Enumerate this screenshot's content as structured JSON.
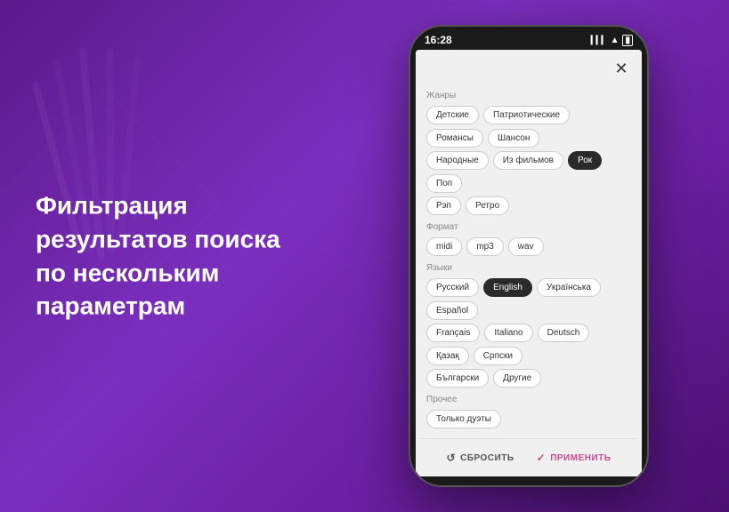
{
  "background": {
    "gradient_start": "#5a1a8a",
    "gradient_end": "#4a1070"
  },
  "hero_text": {
    "line1": "Фильтрация",
    "line2": "результатов поиска",
    "line3": "по нескольким",
    "line4": "параметрам"
  },
  "phone": {
    "status_bar": {
      "time": "16:28",
      "signal": "▲▲▲",
      "wifi": "WiFi",
      "battery": "🔋"
    },
    "close_button_label": "✕",
    "sections": [
      {
        "id": "genres",
        "label": "Жанры",
        "tags": [
          {
            "label": "Детские",
            "active": false
          },
          {
            "label": "Патриотические",
            "active": false
          },
          {
            "label": "Романсы",
            "active": false
          },
          {
            "label": "Шансон",
            "active": false
          },
          {
            "label": "Народные",
            "active": false
          },
          {
            "label": "Из фильмов",
            "active": false
          },
          {
            "label": "Рок",
            "active": true
          },
          {
            "label": "Поп",
            "active": false
          },
          {
            "label": "Рэп",
            "active": false
          },
          {
            "label": "Ретро",
            "active": false
          }
        ]
      },
      {
        "id": "format",
        "label": "Формат",
        "tags": [
          {
            "label": "midi",
            "active": false
          },
          {
            "label": "mp3",
            "active": false
          },
          {
            "label": "wav",
            "active": false
          }
        ]
      },
      {
        "id": "languages",
        "label": "Языки",
        "tags": [
          {
            "label": "Русский",
            "active": false
          },
          {
            "label": "English",
            "active": true
          },
          {
            "label": "Українська",
            "active": false
          },
          {
            "label": "Español",
            "active": false
          },
          {
            "label": "Français",
            "active": false
          },
          {
            "label": "Italiano",
            "active": false
          },
          {
            "label": "Deutsch",
            "active": false
          },
          {
            "label": "Қазақ",
            "active": false
          },
          {
            "label": "Српски",
            "active": false
          },
          {
            "label": "Български",
            "active": false
          },
          {
            "label": "Другие",
            "active": false
          }
        ]
      },
      {
        "id": "other",
        "label": "Прочее",
        "tags": [
          {
            "label": "Только дуэты",
            "active": false
          }
        ]
      }
    ],
    "footer": {
      "reset_icon": "↺",
      "reset_label": "СБРОСИТЬ",
      "apply_icon": "✓",
      "apply_label": "ПРИМЕНИТЬ"
    }
  }
}
